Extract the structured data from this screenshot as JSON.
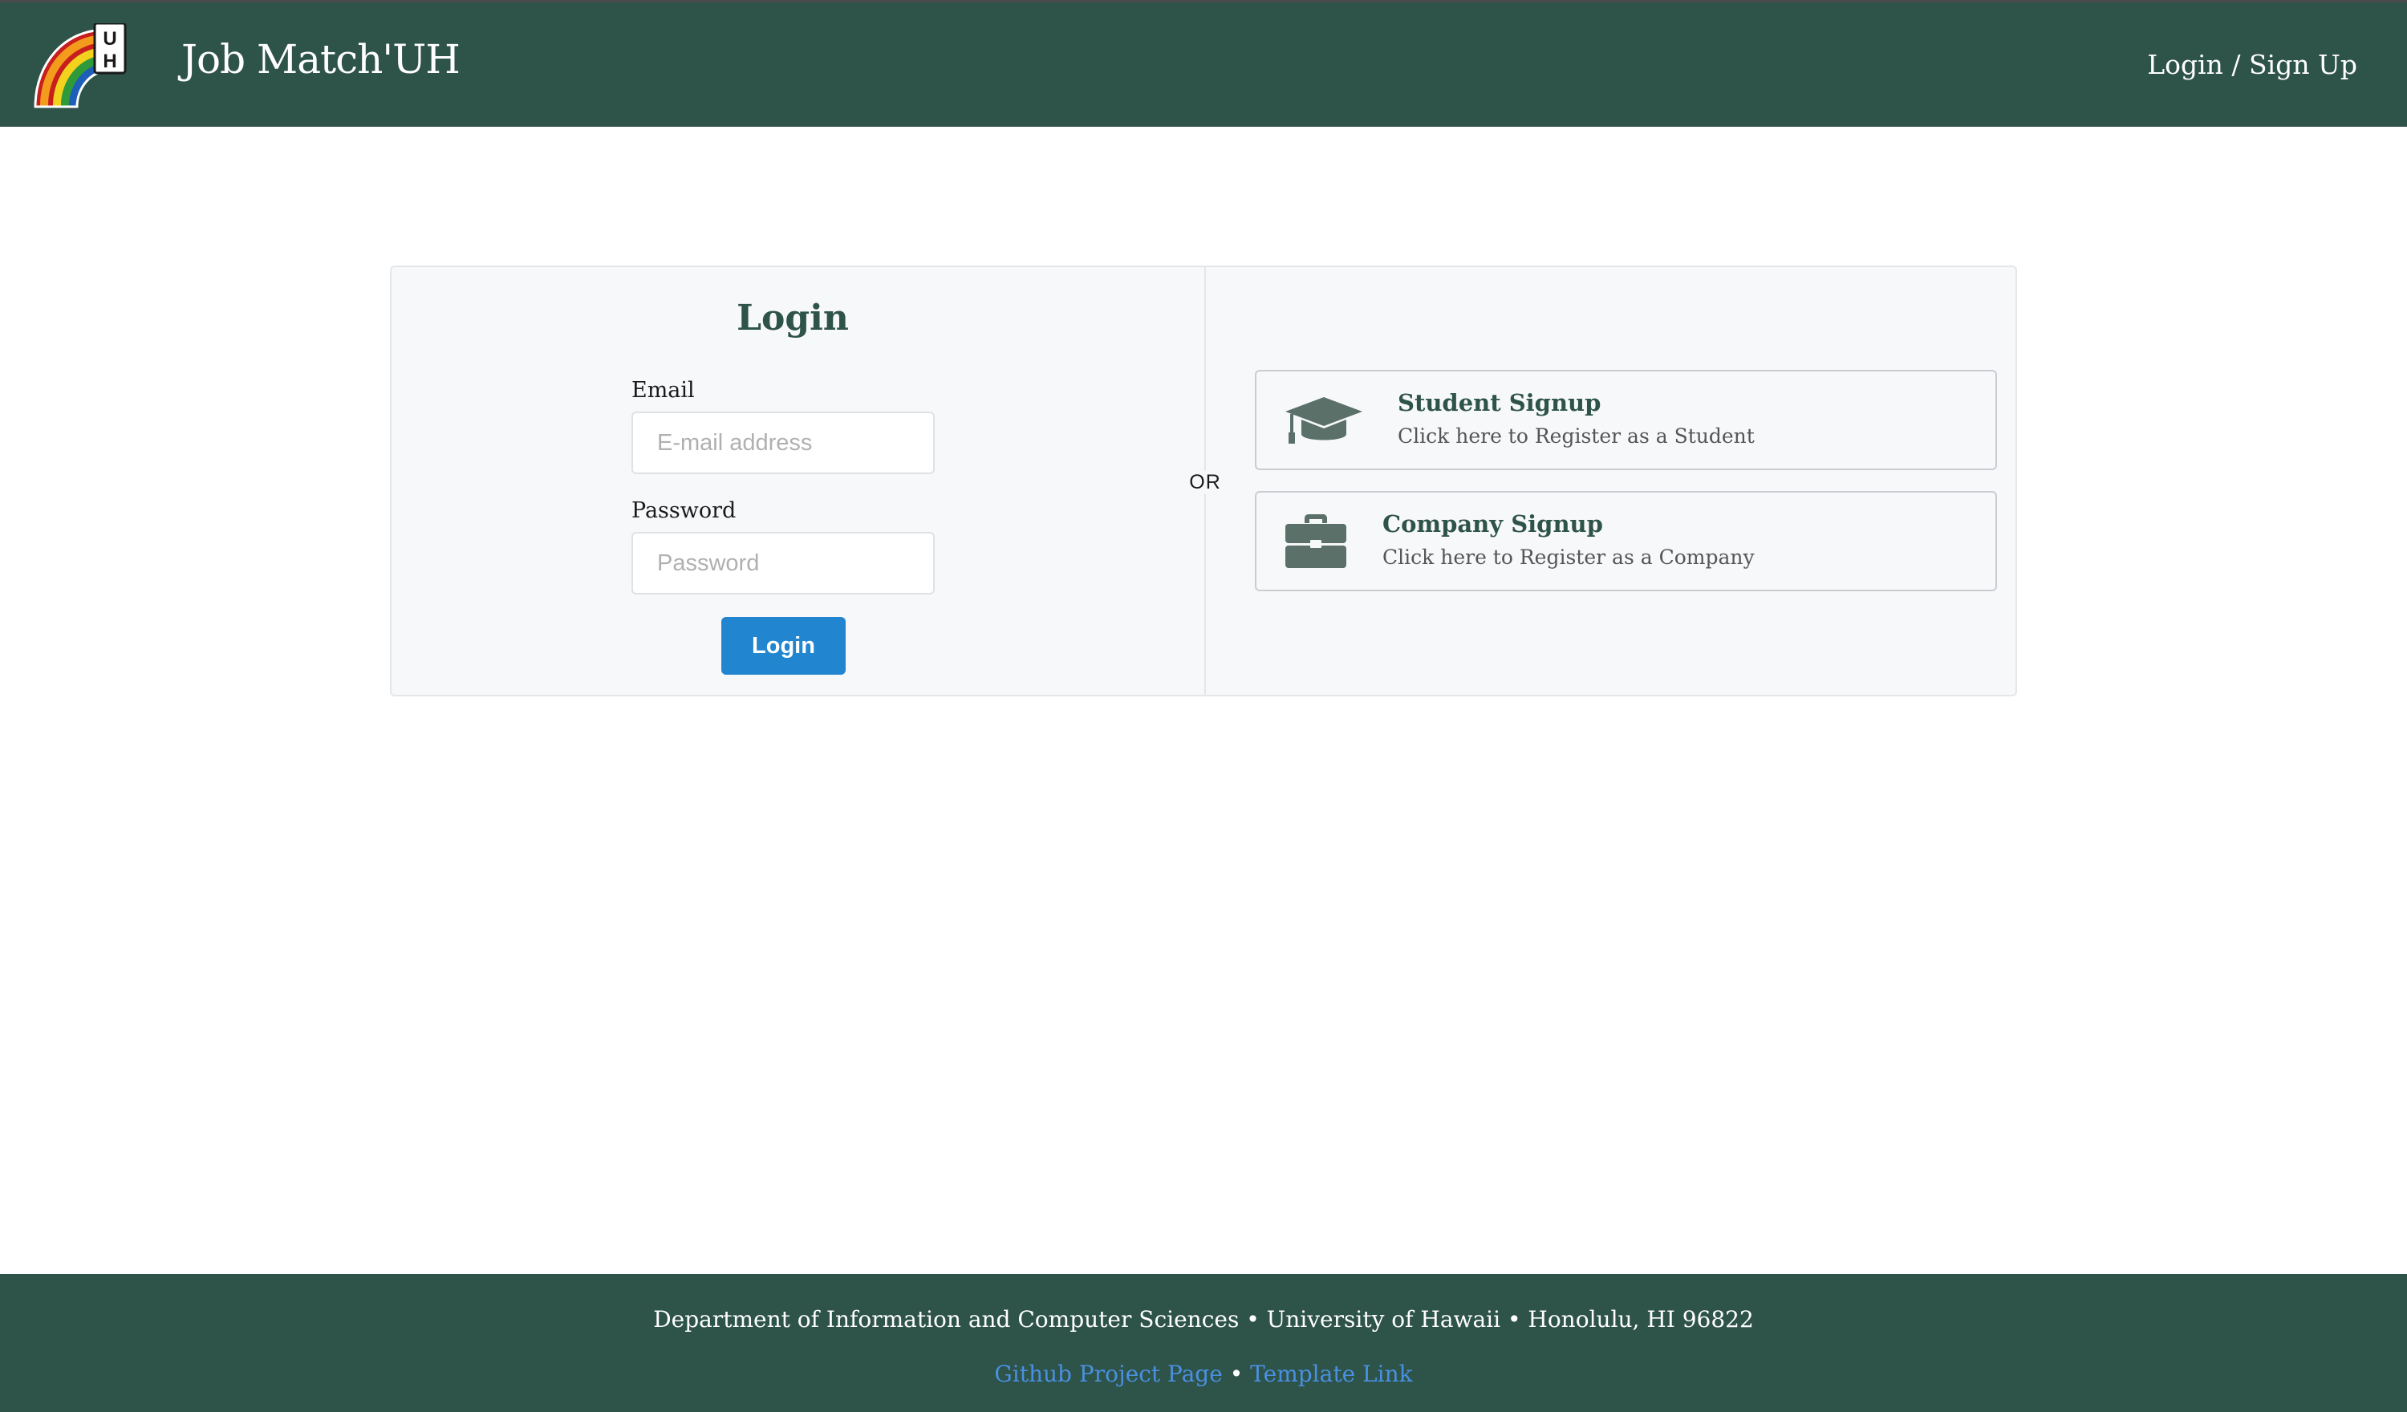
{
  "header": {
    "brand": "Job Match'UH",
    "nav_login": "Login / Sign Up"
  },
  "login": {
    "title": "Login",
    "email_label": "Email",
    "email_placeholder": "E-mail address",
    "email_value": "",
    "password_label": "Password",
    "password_placeholder": "Password",
    "password_value": "",
    "button_label": "Login"
  },
  "divider_text": "OR",
  "signups": [
    {
      "title": "Student Signup",
      "subtitle": "Click here to Register as a Student",
      "icon": "graduation-cap-icon"
    },
    {
      "title": "Company Signup",
      "subtitle": "Click here to Register as a Company",
      "icon": "briefcase-icon"
    }
  ],
  "footer": {
    "address": "Department of Information and Computer Sciences • University of Hawaii • Honolulu, HI 96822",
    "link_github": "Github Project Page",
    "separator": "•",
    "link_template": "Template Link"
  },
  "colors": {
    "header_bg": "#2e5349",
    "accent_blue": "#2185d0",
    "icon_gray": "#5a7068",
    "link_blue": "#4a90e2"
  }
}
